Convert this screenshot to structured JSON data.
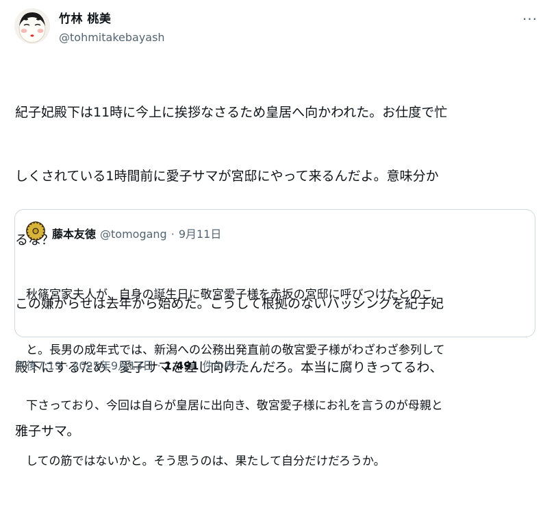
{
  "author": {
    "display_name": "竹林 桃美",
    "handle": "@tohmitakebayash",
    "avatar_icon": "okame-mask-face-icon"
  },
  "more_icon": "more-options-icon",
  "more_label": "···",
  "tweet": {
    "lines": [
      "紀子妃殿下は11時に今上に挨拶なさるため皇居へ向かわれた。お仕度で忙",
      "しくされている1時間前に愛子サマが宮邸にやって来るんだよ。意味分か",
      "るな？",
      "この嫌がらせは去年から始めた。こうして根拠のないバッシングを紀子妃",
      "殿下にするため、愛子サマを差し向けたんだろ。本当に腐りきってるわ、",
      "雅子サマ。"
    ]
  },
  "quote": {
    "display_name": "藤本友徳",
    "handle": "@tomogang",
    "separator": "·",
    "date": "9月11日",
    "avatar_icon": "imperial-chrysanthemum-crest-icon",
    "lines": [
      "秋篠宮家夫人が、自身の誕生日に敬宮愛子様を赤坂の宮邸に呼びつけたとのこ",
      "と。長男の成年式では、新潟への公務出発直前の敬宮愛子様がわざわざ参列して",
      "下さっており、今回は自らが皇居に出向き、敬宮愛子様にお礼を言うのが母親と",
      "しての筋ではないかと。そう思うのは、果たして自分だけだろうか。"
    ]
  },
  "footer": {
    "time": "午後7:19",
    "separator": "·",
    "date": "2025年9月13日",
    "views_count": "1,491",
    "views_label": "件の表示"
  },
  "colors": {
    "text": "#0f1419",
    "secondary": "#536471",
    "border": "#cfd9de",
    "crest_gold": "#c9a227"
  }
}
